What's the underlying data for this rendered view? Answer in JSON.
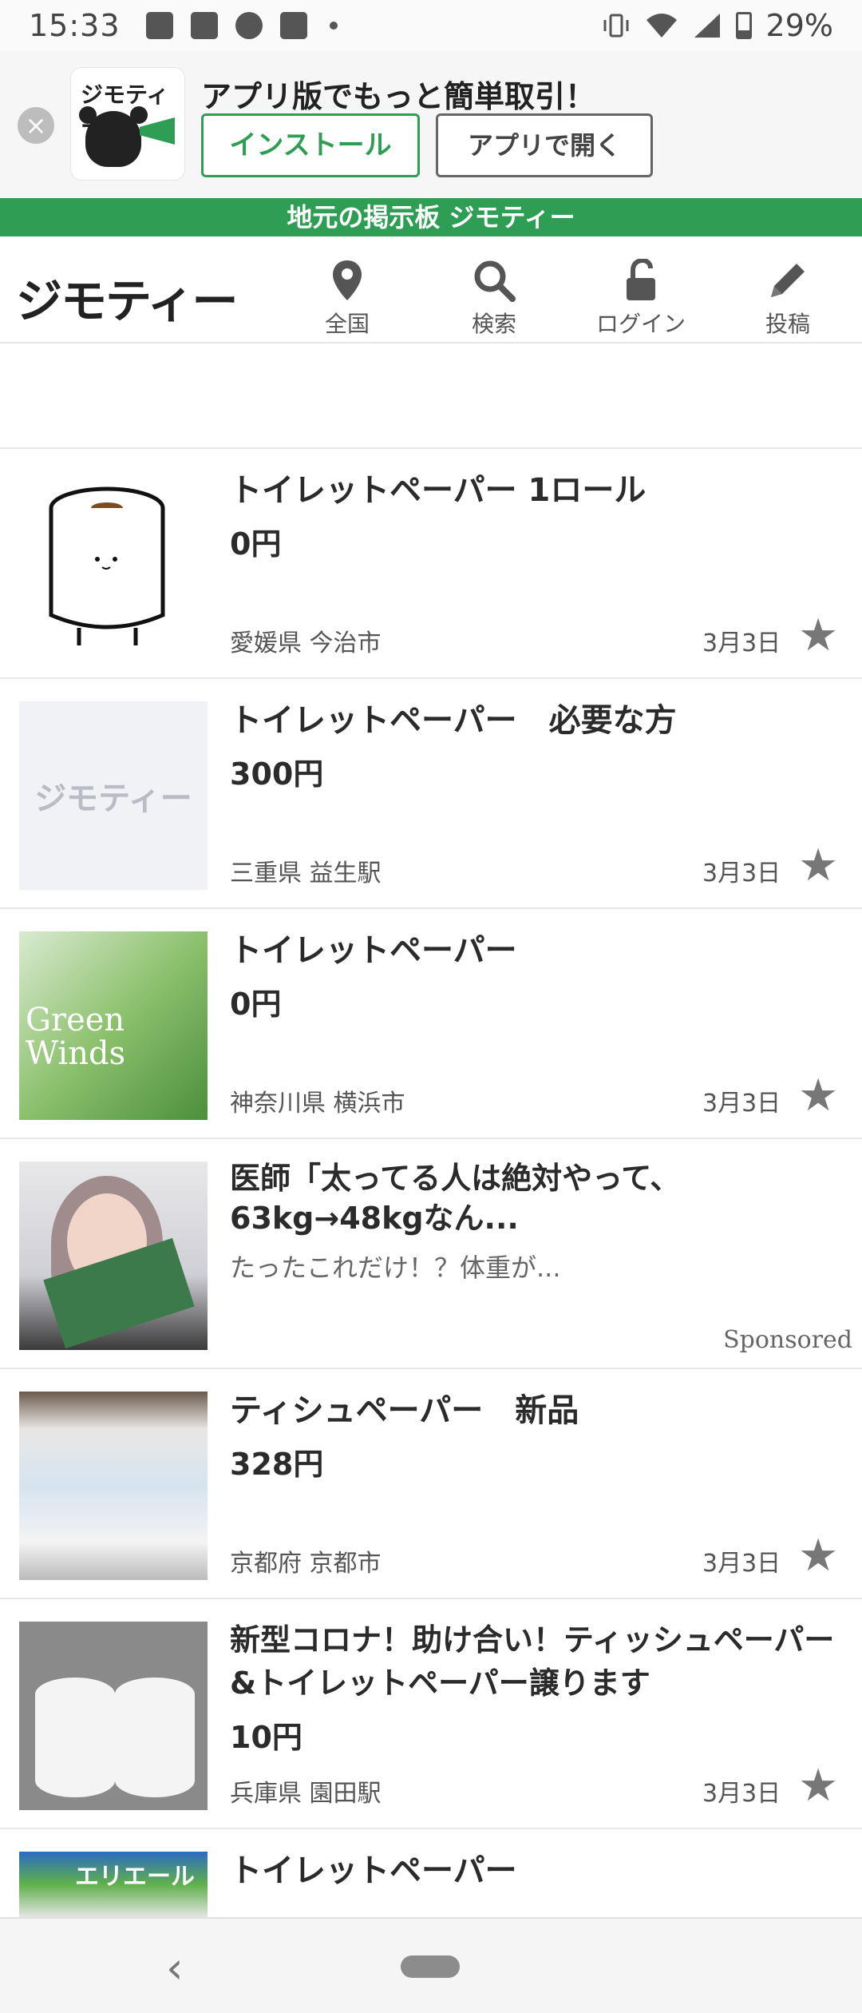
{
  "status_bar": {
    "time": "15:33",
    "battery": "29%"
  },
  "banner": {
    "logo_text": "ジモティー",
    "title": "アプリ版でもっと簡単取引！",
    "install_label": "インストール",
    "open_label": "アプリで開く"
  },
  "green_bar": {
    "text": "地元の掲示板 ジモティー"
  },
  "header": {
    "logo": "ジモティー",
    "nav": [
      {
        "label": "全国",
        "icon": "location-pin-icon"
      },
      {
        "label": "検索",
        "icon": "search-icon"
      },
      {
        "label": "ログイン",
        "icon": "unlock-icon"
      },
      {
        "label": "投稿",
        "icon": "pencil-icon"
      }
    ]
  },
  "listings": [
    {
      "title": "トイレットペーパー 1ロール",
      "price": "0円",
      "location": "愛媛県 今治市",
      "date": "3月3日"
    },
    {
      "title": "トイレットペーパー　必要な方",
      "price": "300円",
      "location": "三重県 益生駅",
      "date": "3月3日",
      "thumb_text": "ジモティー"
    },
    {
      "title": "トイレットペーパー",
      "price": "0円",
      "location": "神奈川県 横浜市",
      "date": "3月3日",
      "thumb_text": "Green Winds"
    },
    {
      "title": "ティシュペーパー　新品",
      "price": "328円",
      "location": "京都府 京都市",
      "date": "3月3日"
    },
    {
      "title": "新型コロナ！助け合い！ティッシュペーパー&トイレットペーパー譲ります",
      "price": "10円",
      "location": "兵庫県 園田駅",
      "date": "3月3日"
    },
    {
      "title": "トイレットペーパー",
      "thumb_text": "エリエール"
    }
  ],
  "ad": {
    "title": "医師「太ってる人は絶対やって、63kg→48kgなん...",
    "subtitle": "たったこれだけ！？体重が...",
    "sponsored": "Sponsored"
  }
}
